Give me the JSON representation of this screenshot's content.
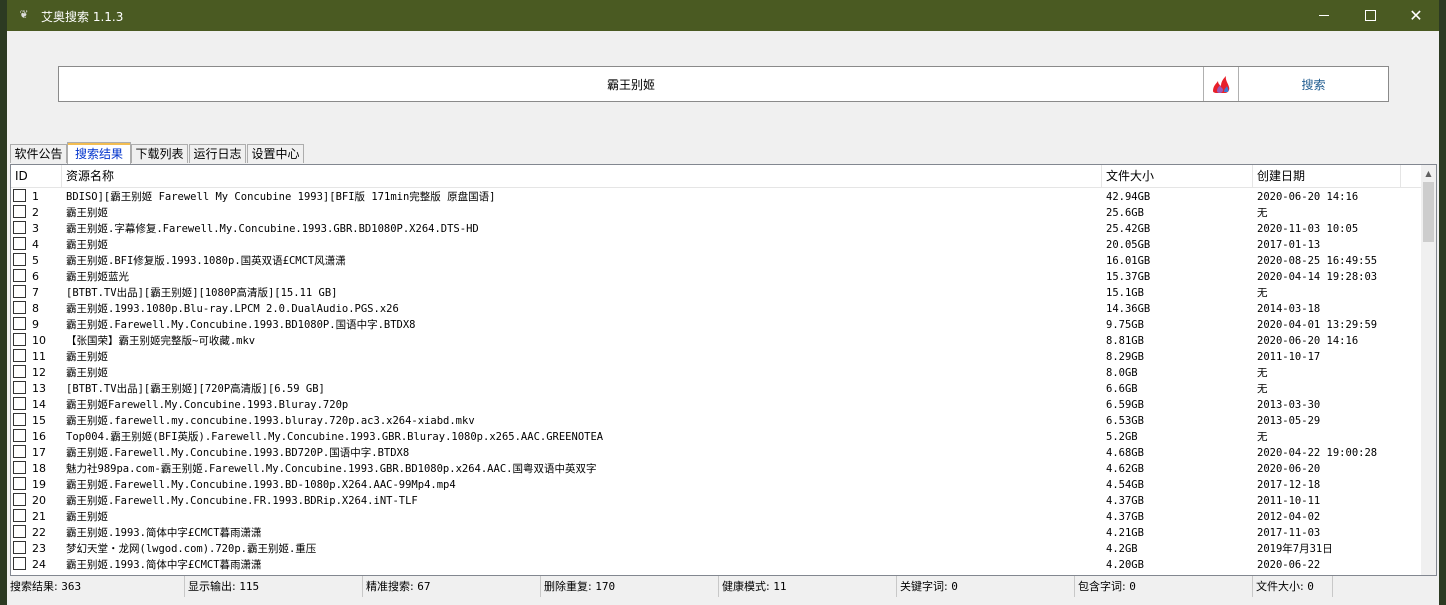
{
  "window": {
    "title": "艾奥搜索 1.1.3"
  },
  "search": {
    "value": "霸王别姬",
    "button_label": "搜索"
  },
  "tabs": [
    {
      "label": "软件公告",
      "active": false
    },
    {
      "label": "搜索结果",
      "active": true
    },
    {
      "label": "下载列表",
      "active": false
    },
    {
      "label": "运行日志",
      "active": false
    },
    {
      "label": "设置中心",
      "active": false
    }
  ],
  "table": {
    "headers": {
      "id": "ID",
      "name": "资源名称",
      "size": "文件大小",
      "date": "创建日期"
    },
    "rows": [
      {
        "id": "1",
        "name": "BDISO][霸王别姬 Farewell My Concubine 1993][BFI版 171min完整版 原盘国语]",
        "size": "42.94GB",
        "date": "2020-06-20 14:16"
      },
      {
        "id": "2",
        "name": "霸王别姬",
        "size": "25.6GB",
        "date": "无"
      },
      {
        "id": "3",
        "name": "霸王别姬.字幕修复.Farewell.My.Concubine.1993.GBR.BD1080P.X264.DTS-HD",
        "size": "25.42GB",
        "date": "2020-11-03 10:05"
      },
      {
        "id": "4",
        "name": "霸王别姬",
        "size": "20.05GB",
        "date": "2017-01-13"
      },
      {
        "id": "5",
        "name": "霸王别姬.BFI修复版.1993.1080p.国英双语£CMCT风潇潇",
        "size": "16.01GB",
        "date": "2020-08-25 16:49:55"
      },
      {
        "id": "6",
        "name": "霸王别姬蓝光",
        "size": "15.37GB",
        "date": "2020-04-14 19:28:03"
      },
      {
        "id": "7",
        "name": "[BTBT.TV出品][霸王别姬][1080P高清版][15.11 GB]",
        "size": "15.1GB",
        "date": "无"
      },
      {
        "id": "8",
        "name": "霸王别姬.1993.1080p.Blu-ray.LPCM 2.0.DualAudio.PGS.x26",
        "size": "14.36GB",
        "date": "2014-03-18"
      },
      {
        "id": "9",
        "name": "霸王别姬.Farewell.My.Concubine.1993.BD1080P.国语中字.BTDX8",
        "size": "9.75GB",
        "date": "2020-04-01 13:29:59"
      },
      {
        "id": "10",
        "name": "【张国荣】霸王别姬完整版~可收藏.mkv",
        "size": "8.81GB",
        "date": "2020-06-20 14:16"
      },
      {
        "id": "11",
        "name": "霸王别姬",
        "size": "8.29GB",
        "date": "2011-10-17"
      },
      {
        "id": "12",
        "name": "霸王别姬",
        "size": "8.0GB",
        "date": "无"
      },
      {
        "id": "13",
        "name": "[BTBT.TV出品][霸王别姬][720P高清版][6.59 GB]",
        "size": "6.6GB",
        "date": "无"
      },
      {
        "id": "14",
        "name": "霸王别姬Farewell.My.Concubine.1993.Bluray.720p",
        "size": "6.59GB",
        "date": "2013-03-30"
      },
      {
        "id": "15",
        "name": "霸王别姬.farewell.my.concubine.1993.bluray.720p.ac3.x264-xiabd.mkv",
        "size": "6.53GB",
        "date": "2013-05-29"
      },
      {
        "id": "16",
        "name": "Top004.霸王别姬(BFI英版).Farewell.My.Concubine.1993.GBR.Bluray.1080p.x265.AAC.GREENOTEA",
        "size": "5.2GB",
        "date": "无"
      },
      {
        "id": "17",
        "name": "霸王别姬.Farewell.My.Concubine.1993.BD720P.国语中字.BTDX8",
        "size": "4.68GB",
        "date": "2020-04-22 19:00:28"
      },
      {
        "id": "18",
        "name": "魅力社989pa.com-霸王别姬.Farewell.My.Concubine.1993.GBR.BD1080p.x264.AAC.国粤双语中英双字",
        "size": "4.62GB",
        "date": "2020-06-20"
      },
      {
        "id": "19",
        "name": "霸王别姬.Farewell.My.Concubine.1993.BD-1080p.X264.AAC-99Mp4.mp4",
        "size": "4.54GB",
        "date": "2017-12-18"
      },
      {
        "id": "20",
        "name": "霸王别姬.Farewell.My.Concubine.FR.1993.BDRip.X264.iNT-TLF",
        "size": "4.37GB",
        "date": "2011-10-11"
      },
      {
        "id": "21",
        "name": "霸王别姬",
        "size": "4.37GB",
        "date": "2012-04-02"
      },
      {
        "id": "22",
        "name": "霸王别姬.1993.简体中字£CMCT暮雨潇潇",
        "size": "4.21GB",
        "date": "2017-11-03"
      },
      {
        "id": "23",
        "name": "梦幻天堂・龙网(lwgod.com).720p.霸王别姬.重压",
        "size": "4.2GB",
        "date": "2019年7月31日"
      },
      {
        "id": "24",
        "name": "霸王别姬.1993.简体中字£CMCT暮雨潇潇",
        "size": "4.20GB",
        "date": "2020-06-22"
      }
    ]
  },
  "status": [
    {
      "label": "搜索结果:",
      "value": "363"
    },
    {
      "label": "显示输出:",
      "value": "115"
    },
    {
      "label": "精准搜索:",
      "value": "67"
    },
    {
      "label": "删除重复:",
      "value": "170"
    },
    {
      "label": "健康模式:",
      "value": "11"
    },
    {
      "label": "关键字词:",
      "value": "0"
    },
    {
      "label": "包含字词:",
      "value": "0"
    },
    {
      "label": "文件大小:",
      "value": "0"
    }
  ]
}
